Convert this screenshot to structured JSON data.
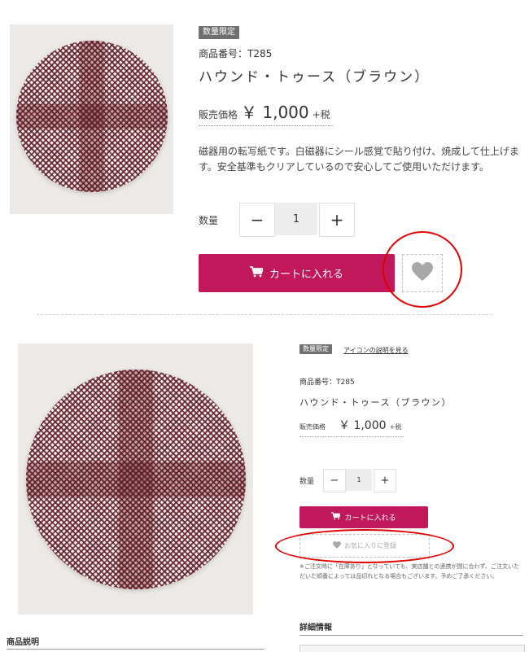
{
  "top": {
    "badge": "数量限定",
    "product_number": "商品番号：T285",
    "product_title": "ハウンド・トゥース（ブラウン）",
    "price_label": "販売価格",
    "price_value": "￥ 1,000",
    "tax_label": "+税",
    "description": "磁器用の転写紙です。白磁器にシール感覚で貼り付け、焼成して仕上げます。安全基準もクリアしているので安心してご使用いただけます。",
    "quantity_label": "数量",
    "qty_minus": "−",
    "qty_value": "1",
    "qty_plus": "+",
    "cart_label": "カートに入れる"
  },
  "bottom": {
    "badge": "数量限定",
    "icon_link": "アイコンの説明を見る",
    "product_number": "商品番号：T285",
    "product_title": "ハウンド・トゥース（ブラウン）",
    "price_label": "販売価格",
    "price_value": "￥ 1,000",
    "tax_label": "+税",
    "quantity_label": "数量",
    "qty_minus": "−",
    "qty_value": "1",
    "qty_plus": "+",
    "cart_label": "カートに入れる",
    "favorite_label": "お気に入りに登録",
    "notice": "※ご注文時に「在庫あり」となっていても、実店舗との連携が間に合わず、ご注文いただいた順番によっては品切れとなる場合もございます。予めご了承ください。",
    "details_heading": "詳細情報",
    "description_heading": "商品説明"
  },
  "colors": {
    "accent": "#c0185a",
    "annotation": "#e00000",
    "badge": "#6f6f6f"
  },
  "icons": {
    "cart": "cart-icon",
    "heart": "heart-icon"
  }
}
